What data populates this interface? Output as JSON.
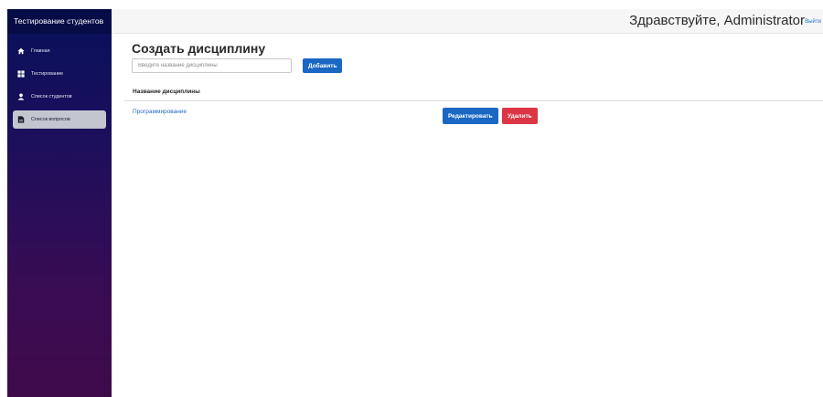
{
  "sidebar": {
    "brand": "Тестирование студентов",
    "items": [
      {
        "label": "Главная",
        "icon": "home-icon"
      },
      {
        "label": "Тестирование",
        "icon": "grid-icon"
      },
      {
        "label": "Список студентов",
        "icon": "user-icon"
      },
      {
        "label": "Список вопросов",
        "icon": "document-icon",
        "active": true
      }
    ]
  },
  "header": {
    "greeting": "Здравствуйте, Administrator",
    "logout": "Выйти"
  },
  "main": {
    "title": "Создать дисциплину",
    "input_placeholder": "Введите название дисциплины",
    "add_label": "Добавить",
    "table": {
      "column_header": "Название дисциплины",
      "rows": [
        {
          "name": "Программирование",
          "edit_label": "Редактировать",
          "delete_label": "Удалить"
        }
      ]
    }
  },
  "colors": {
    "sidebar_top": "#06105a",
    "sidebar_bottom": "#3f0a4a",
    "primary": "#1a67c4",
    "danger": "#dc3545",
    "link": "#2369c7"
  }
}
